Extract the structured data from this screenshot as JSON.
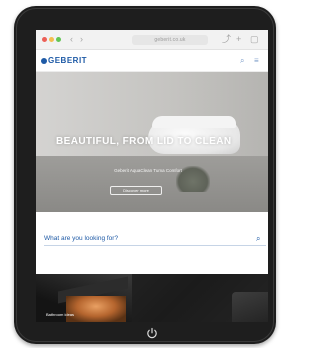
{
  "browser": {
    "url": "geberit.co.uk",
    "back_icon": "‹",
    "forward_icon": "›",
    "share_icon": "⤴",
    "add_icon": "+",
    "tabs_icon": "▢"
  },
  "header": {
    "logo": "GEBERIT",
    "search_icon": "⌕",
    "menu_icon": "≡"
  },
  "hero": {
    "headline": "BEAUTIFUL, FROM LID TO CLEAN",
    "subtext": "Geberit AquaClean Tuma Comfort",
    "button": "Discover more"
  },
  "search": {
    "placeholder": "What are you looking for?"
  },
  "teaser": {
    "caption": "Bathroom ideas"
  },
  "colors": {
    "brand": "#1e5aa6",
    "device": "#1e1e1e"
  }
}
